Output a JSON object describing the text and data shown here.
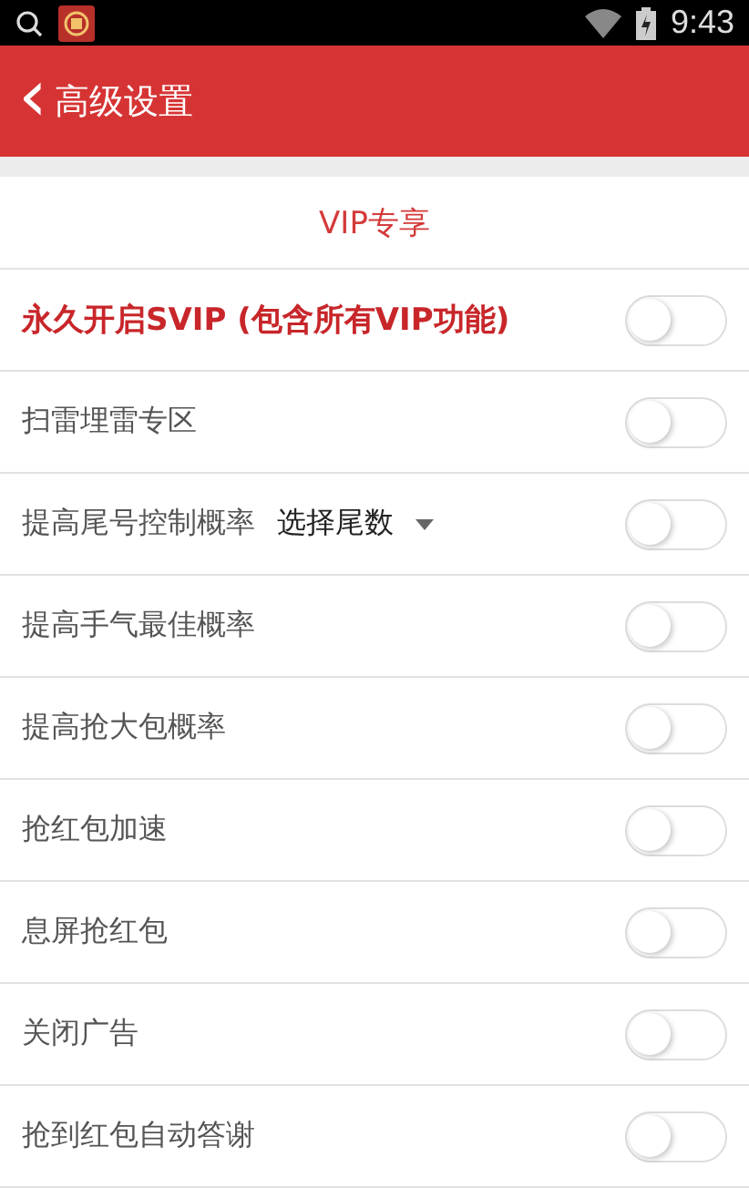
{
  "status_bar": {
    "time": "9:43"
  },
  "header": {
    "back_icon": "‹",
    "title": "高级设置"
  },
  "section": {
    "title": "VIP专享"
  },
  "rows": [
    {
      "kind": "highlight",
      "label": "永久开启SVIP (包含所有VIP功能)",
      "on": false
    },
    {
      "kind": "plain",
      "label": "扫雷埋雷专区",
      "on": false
    },
    {
      "kind": "dropdown",
      "label": "提高尾号控制概率",
      "select": "选择尾数",
      "on": false
    },
    {
      "kind": "plain",
      "label": "提高手气最佳概率",
      "on": false
    },
    {
      "kind": "plain",
      "label": "提高抢大包概率",
      "on": false
    },
    {
      "kind": "plain",
      "label": "抢红包加速",
      "on": false
    },
    {
      "kind": "plain",
      "label": "息屏抢红包",
      "on": false
    },
    {
      "kind": "plain",
      "label": "关闭广告",
      "on": false
    },
    {
      "kind": "plain",
      "label": "抢到红包自动答谢",
      "on": false
    }
  ]
}
